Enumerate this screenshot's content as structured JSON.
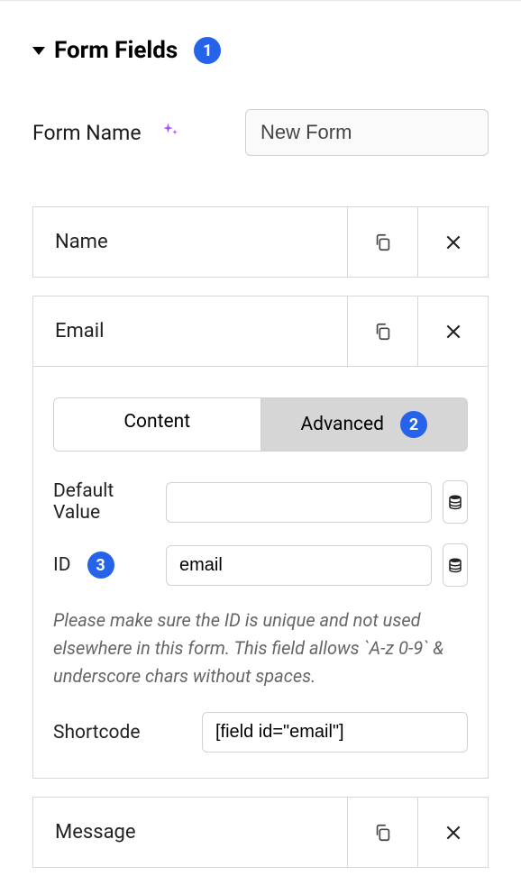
{
  "section": {
    "title": "Form Fields",
    "badge1": "1"
  },
  "form_name": {
    "label": "Form Name",
    "value": "New Form"
  },
  "fields": [
    {
      "label": "Name"
    },
    {
      "label": "Email"
    },
    {
      "label": "Message"
    }
  ],
  "tabs": {
    "content": "Content",
    "advanced": "Advanced",
    "badge2": "2"
  },
  "advanced": {
    "default_value_label": "Default Value",
    "default_value": "",
    "id_label": "ID",
    "id_value": "email",
    "badge3": "3",
    "hint": "Please make sure the ID is unique and not used elsewhere in this form. This field allows `A-z 0-9` & underscore chars without spaces.",
    "shortcode_label": "Shortcode",
    "shortcode_value": "[field id=\"email\"]"
  }
}
